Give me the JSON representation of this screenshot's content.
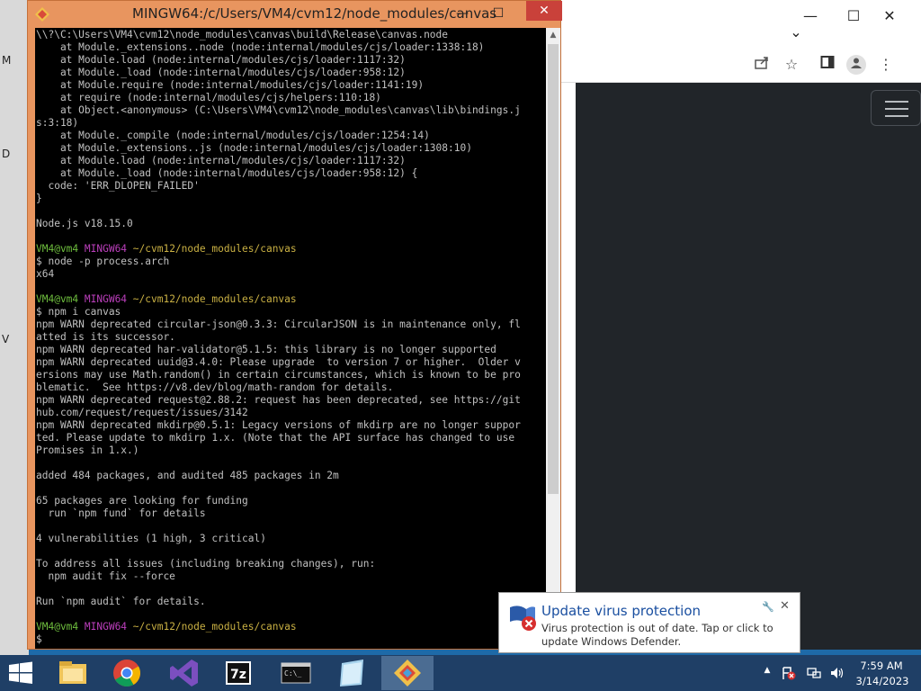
{
  "desktop": {
    "letters": [
      "M",
      "D",
      "V"
    ]
  },
  "browser": {
    "window_controls": {
      "minimize": "—",
      "maximize": "☐",
      "close": "✕"
    },
    "dropdown": "⌄",
    "toolbar_icons": [
      "share-icon",
      "star-icon",
      "sidebar-icon",
      "profile-icon",
      "more-icon"
    ]
  },
  "terminal": {
    "title": "MINGW64:/c/Users/VM4/cvm12/node_modules/canvas",
    "controls": {
      "minimize": "—",
      "maximize": "☐",
      "close": "✕"
    },
    "lines": [
      [
        {
          "t": "\\\\?\\C:\\Users\\VM4\\cvm12\\node_modules\\canvas\\build\\Release\\canvas.node"
        }
      ],
      [
        {
          "t": "    at Module._extensions..node (node:internal/modules/cjs/loader:1338:18)"
        }
      ],
      [
        {
          "t": "    at Module.load (node:internal/modules/cjs/loader:1117:32)"
        }
      ],
      [
        {
          "t": "    at Module._load (node:internal/modules/cjs/loader:958:12)"
        }
      ],
      [
        {
          "t": "    at Module.require (node:internal/modules/cjs/loader:1141:19)"
        }
      ],
      [
        {
          "t": "    at require (node:internal/modules/cjs/helpers:110:18)"
        }
      ],
      [
        {
          "t": "    at Object.<anonymous> (C:\\Users\\VM4\\cvm12\\node_modules\\canvas\\lib\\bindings.j"
        }
      ],
      [
        {
          "t": "s:3:18)"
        }
      ],
      [
        {
          "t": "    at Module._compile (node:internal/modules/cjs/loader:1254:14)"
        }
      ],
      [
        {
          "t": "    at Module._extensions..js (node:internal/modules/cjs/loader:1308:10)"
        }
      ],
      [
        {
          "t": "    at Module.load (node:internal/modules/cjs/loader:1117:32)"
        }
      ],
      [
        {
          "t": "    at Module._load (node:internal/modules/cjs/loader:958:12) {"
        }
      ],
      [
        {
          "t": "  code: 'ERR_DLOPEN_FAILED'"
        }
      ],
      [
        {
          "t": "}"
        }
      ],
      [
        {
          "t": ""
        }
      ],
      [
        {
          "t": "Node.js v18.15.0"
        }
      ],
      [
        {
          "t": ""
        }
      ],
      [
        {
          "t": "VM4@vm4 ",
          "c": "g"
        },
        {
          "t": "MINGW64 ",
          "c": "m"
        },
        {
          "t": "~/cvm12/node_modules/canvas",
          "c": "y"
        }
      ],
      [
        {
          "t": "$ node -p process.arch"
        }
      ],
      [
        {
          "t": "x64"
        }
      ],
      [
        {
          "t": ""
        }
      ],
      [
        {
          "t": "VM4@vm4 ",
          "c": "g"
        },
        {
          "t": "MINGW64 ",
          "c": "m"
        },
        {
          "t": "~/cvm12/node_modules/canvas",
          "c": "y"
        }
      ],
      [
        {
          "t": "$ npm i canvas"
        }
      ],
      [
        {
          "t": "npm WARN deprecated circular-json@0.3.3: CircularJSON is in maintenance only, fl"
        }
      ],
      [
        {
          "t": "atted is its successor."
        }
      ],
      [
        {
          "t": "npm WARN deprecated har-validator@5.1.5: this library is no longer supported"
        }
      ],
      [
        {
          "t": "npm WARN deprecated uuid@3.4.0: Please upgrade  to version 7 or higher.  Older v"
        }
      ],
      [
        {
          "t": "ersions may use Math.random() in certain circumstances, which is known to be pro"
        }
      ],
      [
        {
          "t": "blematic.  See https://v8.dev/blog/math-random for details."
        }
      ],
      [
        {
          "t": "npm WARN deprecated request@2.88.2: request has been deprecated, see https://git"
        }
      ],
      [
        {
          "t": "hub.com/request/request/issues/3142"
        }
      ],
      [
        {
          "t": "npm WARN deprecated mkdirp@0.5.1: Legacy versions of mkdirp are no longer suppor"
        }
      ],
      [
        {
          "t": "ted. Please update to mkdirp 1.x. (Note that the API surface has changed to use"
        }
      ],
      [
        {
          "t": "Promises in 1.x.)"
        }
      ],
      [
        {
          "t": ""
        }
      ],
      [
        {
          "t": "added 484 packages, and audited 485 packages in 2m"
        }
      ],
      [
        {
          "t": ""
        }
      ],
      [
        {
          "t": "65 packages are looking for funding"
        }
      ],
      [
        {
          "t": "  run `npm fund` for details"
        }
      ],
      [
        {
          "t": ""
        }
      ],
      [
        {
          "t": "4 vulnerabilities (1 high, 3 critical)"
        }
      ],
      [
        {
          "t": ""
        }
      ],
      [
        {
          "t": "To address all issues (including breaking changes), run:"
        }
      ],
      [
        {
          "t": "  npm audit fix --force"
        }
      ],
      [
        {
          "t": ""
        }
      ],
      [
        {
          "t": "Run `npm audit` for details."
        }
      ],
      [
        {
          "t": ""
        }
      ],
      [
        {
          "t": "VM4@vm4 ",
          "c": "g"
        },
        {
          "t": "MINGW64 ",
          "c": "m"
        },
        {
          "t": "~/cvm12/node_modules/canvas",
          "c": "y"
        }
      ],
      [
        {
          "t": "$"
        }
      ]
    ]
  },
  "notification": {
    "title": "Update virus protection",
    "body": "Virus protection is out of date. Tap or click to update Windows Defender.",
    "pin": "🔧",
    "close": "✕"
  },
  "taskbar": {
    "apps": [
      "file-explorer",
      "chrome",
      "visual-studio",
      "7zip",
      "command-prompt",
      "notepad",
      "git-bash"
    ],
    "tray": {
      "expand": "▲",
      "time": "7:59 AM",
      "date": "3/14/2023"
    }
  },
  "colors": {
    "terminal_frame": "#e8955f",
    "prompt_user": "#6fbf3e",
    "prompt_host": "#bc3fbc",
    "prompt_path": "#c9b043",
    "taskbar": "#1f3f66",
    "close_button": "#c9413a"
  }
}
